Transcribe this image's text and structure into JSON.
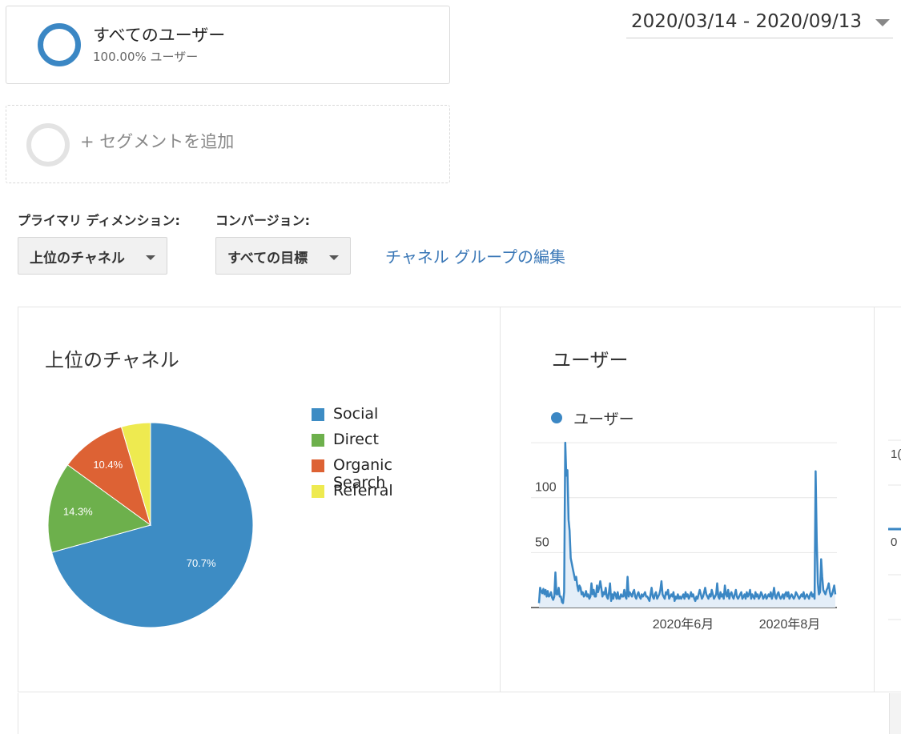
{
  "segment": {
    "title": "すべてのユーザー",
    "subtitle": "100.00% ユーザー",
    "ring_color": "#3b87c4"
  },
  "add_segment": {
    "label": "+ セグメントを追加"
  },
  "date_range": {
    "value": "2020/03/14 - 2020/09/13"
  },
  "controls": {
    "primary_dimension_label": "プライマリ ディメンション:",
    "primary_dimension_value": "上位のチャネル",
    "conversion_label": "コンバージョン:",
    "conversion_value": "すべての目標",
    "edit_link": "チャネル グループの編集"
  },
  "panels": {
    "channels_title": "上位のチャネル",
    "users_title": "ユーザー",
    "users_legend": "ユーザー",
    "third_tick_top": "1(",
    "third_tick_zero": "0"
  },
  "chart_data": [
    {
      "type": "pie",
      "title": "上位のチャネル",
      "series": [
        {
          "name": "Social",
          "value": 70.7,
          "label": "70.7%",
          "color": "#3d8cc4"
        },
        {
          "name": "Direct",
          "value": 14.3,
          "label": "14.3%",
          "color": "#6db04c"
        },
        {
          "name": "Organic Search",
          "value": 10.4,
          "label": "10.4%",
          "color": "#dd6234"
        },
        {
          "name": "Referral",
          "value": 4.6,
          "label": "",
          "color": "#eeea50"
        }
      ],
      "legend_position": "right"
    },
    {
      "type": "area",
      "title": "ユーザー",
      "series": [
        {
          "name": "ユーザー",
          "color": "#3b87c4",
          "values": [
            4,
            18,
            15,
            13,
            17,
            12,
            16,
            10,
            15,
            10,
            11,
            14,
            9,
            7,
            10,
            32,
            12,
            12,
            18,
            10,
            10,
            5,
            4,
            14,
            150,
            120,
            125,
            80,
            70,
            45,
            40,
            35,
            30,
            25,
            28,
            20,
            15,
            20,
            18,
            12,
            14,
            10,
            11,
            15,
            10,
            12,
            8,
            10,
            22,
            12,
            16,
            10,
            10,
            20,
            14,
            18,
            24,
            18,
            10,
            14,
            12,
            18,
            10,
            8,
            14,
            22,
            6,
            12,
            8,
            14,
            12,
            8,
            14,
            8,
            8,
            12,
            10,
            10,
            16,
            10,
            8,
            28,
            10,
            14,
            12,
            10,
            14,
            16,
            10,
            8,
            12,
            14,
            10,
            8,
            12,
            10,
            12,
            14,
            10,
            10,
            8,
            6,
            12,
            18,
            10,
            8,
            12,
            14,
            8,
            10,
            12,
            16,
            24,
            12,
            10,
            8,
            14,
            12,
            16,
            8,
            10,
            12,
            10,
            14,
            6,
            10,
            8,
            12,
            8,
            10,
            8,
            10,
            12,
            8,
            14,
            10,
            12,
            8,
            10,
            14,
            10,
            12,
            8,
            6,
            10,
            8,
            12,
            16,
            12,
            8,
            10,
            14,
            18,
            12,
            10,
            8,
            12,
            10,
            16,
            12,
            8,
            10,
            12,
            22,
            10,
            8,
            14,
            10,
            12,
            8,
            20,
            12,
            10,
            16,
            8,
            12,
            14,
            10,
            8,
            12,
            16,
            10,
            8,
            10,
            12,
            14,
            8,
            10,
            12,
            8,
            14,
            10,
            12,
            16,
            8,
            12,
            10,
            8,
            14,
            10,
            12,
            8,
            10,
            14,
            12,
            8,
            10,
            12,
            8,
            10,
            12,
            10,
            14,
            8,
            12,
            18,
            10,
            8,
            12,
            14,
            10,
            8,
            10,
            12,
            8,
            12,
            14,
            10,
            14,
            8,
            10,
            12,
            10,
            8,
            10,
            14,
            12,
            10,
            8,
            10,
            12,
            10,
            14,
            8,
            10,
            12,
            10,
            8,
            12,
            14,
            10,
            12,
            8,
            124,
            60,
            22,
            12,
            14,
            44,
            28,
            16,
            14,
            12,
            16,
            18,
            22,
            14,
            10,
            12,
            16,
            20,
            12
          ]
        }
      ],
      "y_ticks": [
        50,
        100,
        150
      ],
      "ylim": [
        0,
        150
      ],
      "x_tick_labels": [
        "2020年6月",
        "2020年8月"
      ],
      "grid": true
    }
  ]
}
